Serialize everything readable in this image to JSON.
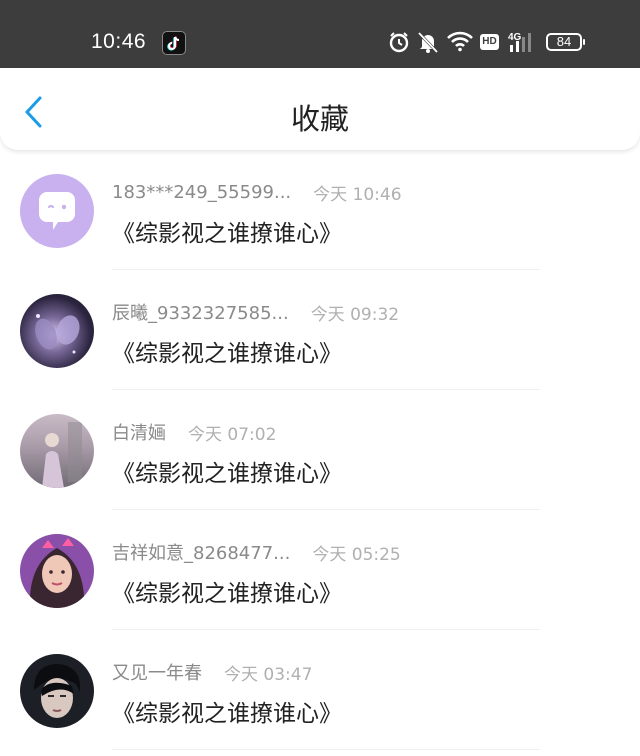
{
  "status_bar": {
    "time": "10:46",
    "battery": "84",
    "icons": [
      "tiktok-icon",
      "alarm-icon",
      "mute-icon",
      "wifi-icon",
      "hd-icon",
      "4g-signal-icon",
      "battery-icon"
    ]
  },
  "nav": {
    "title": "收藏",
    "back_icon": "chevron-left-icon"
  },
  "colors": {
    "status_bar_bg": "#3d3d3d",
    "accent": "#1a9be6",
    "bubble_purple": "#c9b0ee"
  },
  "items": [
    {
      "username": "183***249_55599...",
      "time": "今天 10:46",
      "title": "《综影视之谁撩谁心》",
      "avatar": "chat-bubble-avatar"
    },
    {
      "username": "辰曦_9332327585...",
      "time": "今天 09:32",
      "title": "《综影视之谁撩谁心》",
      "avatar": "user-avatar"
    },
    {
      "username": "白清婳",
      "time": "今天 07:02",
      "title": "《综影视之谁撩谁心》",
      "avatar": "user-avatar"
    },
    {
      "username": "吉祥如意_8268477...",
      "time": "今天 05:25",
      "title": "《综影视之谁撩谁心》",
      "avatar": "user-avatar"
    },
    {
      "username": "又见一年春",
      "time": "今天 03:47",
      "title": "《综影视之谁撩谁心》",
      "avatar": "user-avatar"
    }
  ]
}
